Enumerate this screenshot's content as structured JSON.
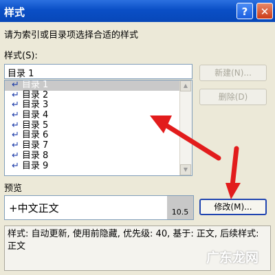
{
  "window": {
    "title": "样式",
    "help_glyph": "?",
    "close_glyph": "✕"
  },
  "prompt": "请为索引或目录项选择合适的样式",
  "styles_label": "样式(S):",
  "style_value": "目录 1",
  "style_list": [
    "目录 1",
    "目录 2",
    "目录 3",
    "目录 4",
    "目录 5",
    "目录 6",
    "目录 7",
    "目录 8",
    "目录 9"
  ],
  "selected_index": 0,
  "buttons": {
    "new": "新建(N)...",
    "delete": "删除(D)",
    "modify": "修改(M)..."
  },
  "preview_label": "预览",
  "preview_text": "+中文正文",
  "preview_size": "10.5",
  "description": "样式: 自动更新, 使用前隐藏, 优先级: 40, 基于: 正文, 后续样式: 正文",
  "watermark": "广东龙网",
  "accent_color": "#e21c1c"
}
